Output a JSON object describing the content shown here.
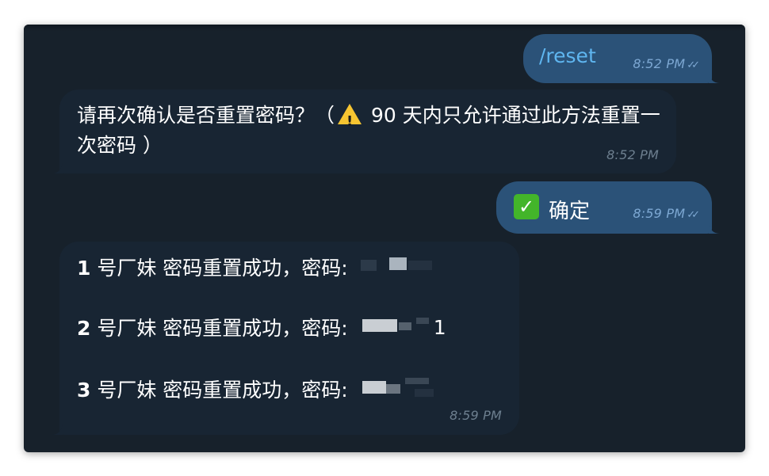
{
  "messages": [
    {
      "id": "reset-command",
      "direction": "outgoing",
      "text": "/reset",
      "time": "8:52 PM",
      "status": "read"
    },
    {
      "id": "confirm-prompt",
      "direction": "incoming",
      "text_part1": "请再次确认是否重置密码？（",
      "icon": "warning-icon",
      "text_part2": " 90 天内只允许通过此方法重置一次密码 ）",
      "time": "8:52 PM"
    },
    {
      "id": "confirm-reply",
      "direction": "outgoing",
      "icon": "check-mark-button-icon",
      "text": "确定",
      "time": "8:59 PM",
      "status": "read"
    },
    {
      "id": "reset-results",
      "direction": "incoming",
      "rows": [
        {
          "index": "1",
          "text": " 号厂妹 密码重置成功，密码:",
          "password_visible_suffix": ""
        },
        {
          "index": "2",
          "text": " 号厂妹 密码重置成功，密码:",
          "password_visible_suffix": "1"
        },
        {
          "index": "3",
          "text": " 号厂妹 密码重置成功，密码:",
          "password_visible_suffix": ""
        }
      ],
      "time": "8:59 PM"
    }
  ],
  "read_ticks": "✓✓",
  "colors": {
    "background": "#17212b",
    "outgoing_bubble": "#2b5278",
    "incoming_bubble": "#182533",
    "command_link": "#5fb6f0",
    "warning": "#f7c531",
    "check_green": "#43b52a"
  }
}
